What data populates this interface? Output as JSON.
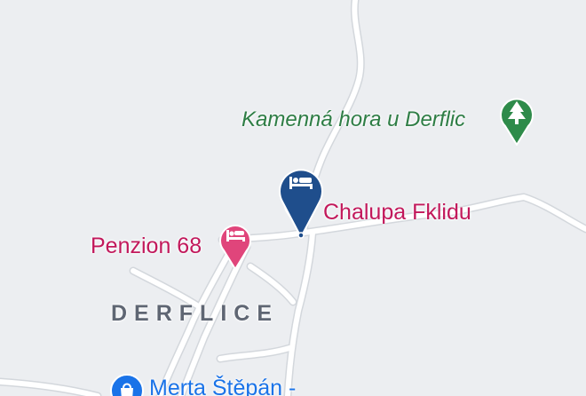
{
  "map": {
    "background_color": "#eceef1",
    "road_color": "#ffffff",
    "road_edge_color": "#d3d7dc"
  },
  "places": {
    "peak": {
      "name": "Kamenná hora u Derflic",
      "icon": "tree-icon",
      "color": "#2e7d45"
    },
    "selected_hotel": {
      "name": "Chalupa Fklidu",
      "icon": "bed-icon",
      "color": "#c2185b",
      "marker_color": "#1f4e8c"
    },
    "hotel": {
      "name": "Penzion 68",
      "icon": "bed-icon",
      "color": "#c2185b"
    },
    "shop": {
      "name": "Merta Štěpán -",
      "icon": "shopping-bag-icon",
      "color": "#1a73e8"
    }
  },
  "area": {
    "name": "DERFLICE"
  }
}
